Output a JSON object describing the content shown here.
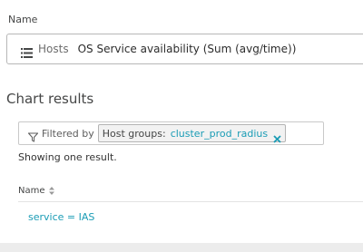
{
  "name_label": "Name",
  "metric": {
    "entity": "Hosts",
    "name": "OS Service availability (Sum (avg/time))"
  },
  "chart_results": {
    "title": "Chart results",
    "filter": {
      "prefix": "Filtered by",
      "chip_key": "Host groups:",
      "chip_value": "cluster_prod_radius"
    },
    "count_text": "Showing one result.",
    "column_header": "Name",
    "rows": [
      {
        "label": "service = IAS"
      }
    ]
  },
  "colors": {
    "link": "#1a9cb5",
    "chip_value": "#1a9cb5"
  }
}
